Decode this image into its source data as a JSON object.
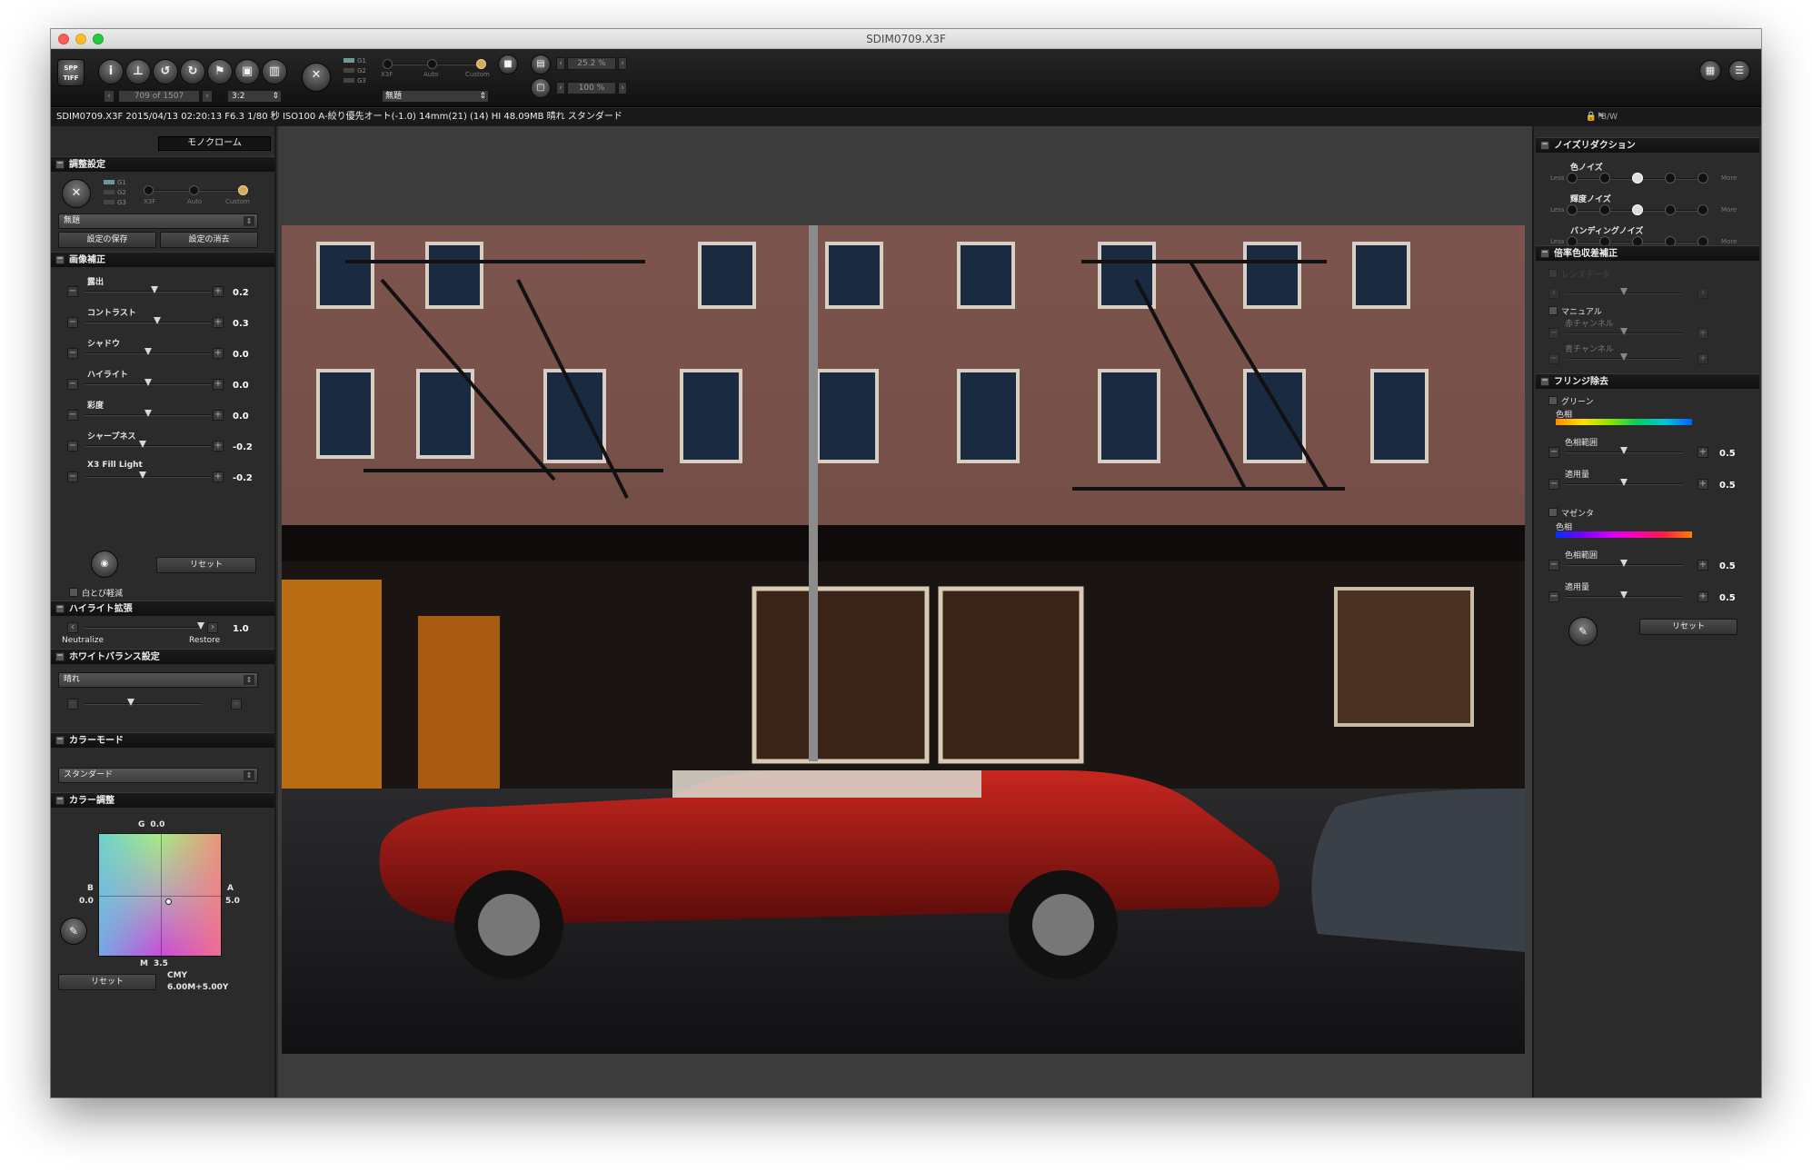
{
  "window": {
    "title": "SDIM0709.X3F"
  },
  "toolbar": {
    "logo": "SPP\nTIFF",
    "counter": "709 of 1507",
    "ratio": "3:2",
    "mode_labels": [
      "G1",
      "G2",
      "G3"
    ],
    "preset_labels": [
      "X3F",
      "Auto",
      "Custom"
    ],
    "preset_select": "無題",
    "zoom1": "25.2 %",
    "zoom2": "100 %"
  },
  "infobar": {
    "text": "SDIM0709.X3F 2015/04/13 02:20:13 F6.3 1/80 秒 ISO100 A-絞り優先オート(-1.0) 14mm(21) (14) HI 48.09MB 晴れ スタンダード",
    "right": "B/W"
  },
  "left": {
    "mono_tab": "モノクローム",
    "adjust": {
      "title": "調整設定",
      "mode_labels": [
        "G1",
        "G2",
        "G3"
      ],
      "preset_labels": [
        "X3F",
        "Auto",
        "Custom"
      ],
      "select": "無題",
      "save": "設定の保存",
      "delete": "設定の消去"
    },
    "image": {
      "title": "画像補正",
      "sliders": [
        {
          "label": "露出",
          "value": "0.2",
          "pos": 0.55
        },
        {
          "label": "コントラスト",
          "value": "0.3",
          "pos": 0.57
        },
        {
          "label": "シャドウ",
          "value": "0.0",
          "pos": 0.5
        },
        {
          "label": "ハイライト",
          "value": "0.0",
          "pos": 0.5
        },
        {
          "label": "彩度",
          "value": "0.0",
          "pos": 0.5
        },
        {
          "label": "シャープネス",
          "value": "-0.2",
          "pos": 0.46
        },
        {
          "label": "X3 Fill Light",
          "value": "-0.2",
          "pos": 0.46
        }
      ],
      "reset": "リセット",
      "blowout": "白とび軽減"
    },
    "highlight": {
      "title": "ハイライト拡張",
      "value": "1.0",
      "neutralize": "Neutralize",
      "restore": "Restore"
    },
    "wb": {
      "title": "ホワイトバランス設定",
      "select": "晴れ"
    },
    "colormode": {
      "title": "カラーモード",
      "select": "スタンダード"
    },
    "coloradj": {
      "title": "カラー調整",
      "g": "G",
      "g_val": "0.0",
      "b": "B",
      "b_val": "0.0",
      "a": "A",
      "a_val": "5.0",
      "m": "M",
      "m_val": "3.5",
      "reset": "リセット",
      "cmy_label": "CMY",
      "cmy_value": "6.00M+5.00Y"
    }
  },
  "right": {
    "nr": {
      "title": "ノイズリダクション",
      "rows": [
        {
          "label": "色ノイズ",
          "less": "Less",
          "more": "More",
          "level": 0.5
        },
        {
          "label": "輝度ノイズ",
          "less": "Less",
          "more": "More",
          "level": 0.5
        },
        {
          "label": "バンディングノイズ",
          "less": "Less",
          "more": "More",
          "level": 0
        }
      ]
    },
    "ca": {
      "title": "倍率色収差補正",
      "auto": "レンズデータ",
      "manual": "マニュアル",
      "red": "赤チャンネル",
      "blue": "青チャンネル"
    },
    "fringe": {
      "title": "フリンジ除去",
      "green": {
        "label": "グリーン",
        "hue": "色相",
        "range": "色相範囲",
        "range_val": "0.5",
        "amount": "適用量",
        "amount_val": "0.5"
      },
      "magenta": {
        "label": "マゼンタ",
        "hue": "色相",
        "range": "色相範囲",
        "range_val": "0.5",
        "amount": "適用量",
        "amount_val": "0.5"
      },
      "reset": "リセット"
    }
  }
}
